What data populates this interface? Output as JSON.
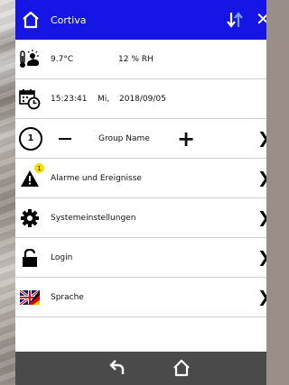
{
  "header": {
    "title": "Cortiva",
    "home_icon": "home-icon",
    "sort_icon": "sort-arrows-icon",
    "close_icon": "close-icon",
    "close_glyph": "✕",
    "bg_color": "#1515e6"
  },
  "weather": {
    "temperature": "9.7°C",
    "humidity": "12 % RH",
    "icon": "thermometer-sun-cloud-icon"
  },
  "datetime": {
    "time": "15:23:41",
    "day": "Mi,",
    "date": "2018/09/05",
    "icon": "calendar-clock-icon"
  },
  "group": {
    "number": "1",
    "minus": "–",
    "name": "Group Name",
    "plus": "+"
  },
  "menu": [
    {
      "label": "Alarme und Ereignisse",
      "icon": "warning-icon",
      "badge": "1"
    },
    {
      "label": "Systemeinstellungen",
      "icon": "gear-icon"
    },
    {
      "label": "Login",
      "icon": "unlock-icon"
    },
    {
      "label": "Sprache",
      "icon": "flag-uk-de-icon"
    }
  ],
  "chevron": "❯",
  "footer": {
    "back_icon": "back-arrow-icon",
    "home_icon": "home-icon"
  },
  "colors": {
    "badge": "#f1e000",
    "footer": "#4a4a4a"
  }
}
